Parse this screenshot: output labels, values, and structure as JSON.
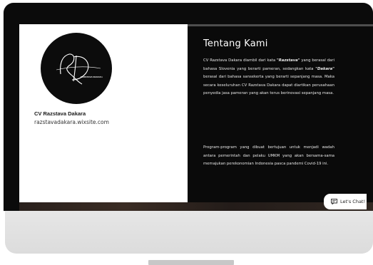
{
  "profile": {
    "company_name": "CV Razstava Dakara",
    "website": "razstavadakara.wixsite.com"
  },
  "logo": {
    "monogram": "RD",
    "wordmark": "RAZSTAVA DAKARA"
  },
  "about": {
    "title": "Tentang Kami",
    "p1_a": "CV Razstava Dakara diambil dari kata ",
    "p1_b": "\"Razstava\"",
    "p1_c": " yang berasal dari bahasa Slovenia yang berarti pameran, sedangkan kata ",
    "p1_d": "\"Dakara\"",
    "p1_e": " berasal dari bahasa sansekerta yang berarti sepanjang masa. Maka secara keseluruhan CV Razstava Dakara dapat diartikan perusahaan penyedia jasa pameran yang akan terus berinovasi sepanjang masa.",
    "p2": "Program-program yang dibuat bertujuan untuk menjadi wadah antara pemerintah dan pelaku UMKM yang akan bersama-sama memajukan perekonomian Indonesia pasca pandemi Covid-19 ini."
  },
  "chat": {
    "label": "Let's Chat!",
    "icon": "chat-bubble-icon"
  },
  "colors": {
    "screen_bg": "#0a0a0a",
    "panel_bg": "#ffffff",
    "text_light": "#e8e8e8"
  }
}
